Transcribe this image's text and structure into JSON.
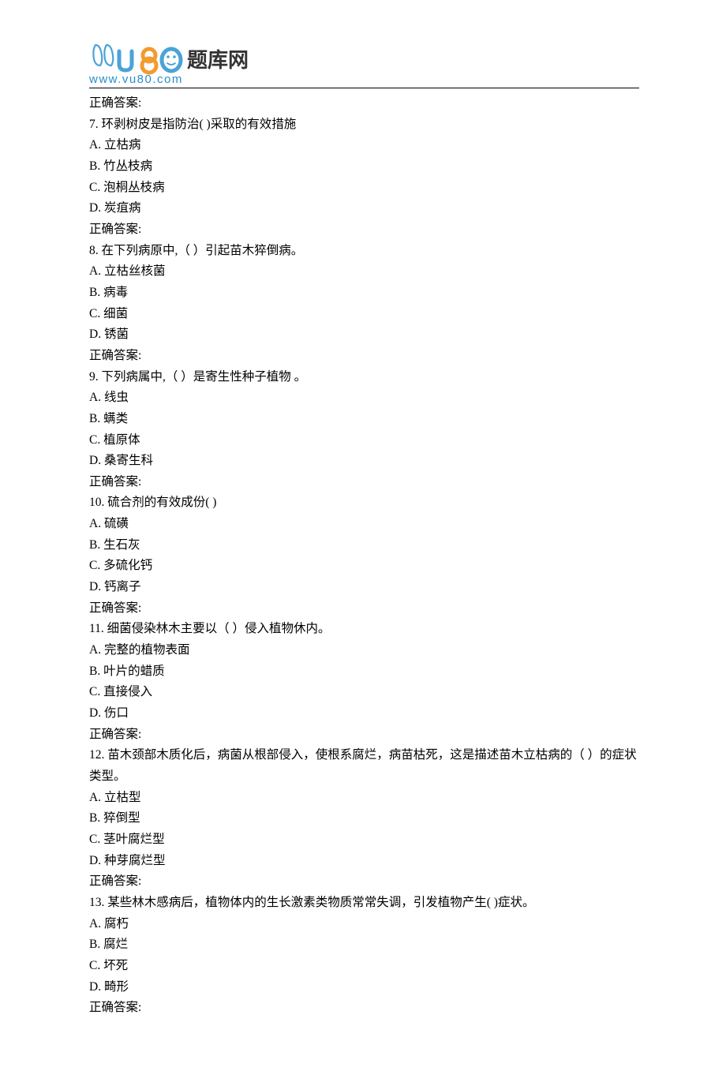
{
  "logo": {
    "url_text": "www.vu80.com",
    "title_text": "题库网"
  },
  "items": [
    {
      "text": "正确答案:"
    },
    {
      "text": "7.   环剥树皮是指防治( )采取的有效措施"
    },
    {
      "text": "A. 立枯病"
    },
    {
      "text": "B. 竹丛枝病"
    },
    {
      "text": "C. 泡桐丛枝病"
    },
    {
      "text": "D. 炭疽病"
    },
    {
      "text": "正确答案:"
    },
    {
      "text": "8.   在下列病原中,（  ）引起苗木猝倒病。"
    },
    {
      "text": "A. 立枯丝核菌"
    },
    {
      "text": "B. 病毒"
    },
    {
      "text": "C. 细菌"
    },
    {
      "text": "D. 锈菌"
    },
    {
      "text": "正确答案:"
    },
    {
      "text": "9.   下列病属中,（  ）是寄生性种子植物 。"
    },
    {
      "text": "A. 线虫"
    },
    {
      "text": "B. 螨类"
    },
    {
      "text": "C. 植原体"
    },
    {
      "text": "D. 桑寄生科"
    },
    {
      "text": "正确答案:"
    },
    {
      "text": "10.   硫合剂的有效成份( )"
    },
    {
      "text": "A. 硫磺"
    },
    {
      "text": "B. 生石灰"
    },
    {
      "text": "C. 多硫化钙"
    },
    {
      "text": "D. 钙离子"
    },
    {
      "text": "正确答案:"
    },
    {
      "text": "11.   细菌侵染林木主要以（  ）侵入植物休内。"
    },
    {
      "text": "A. 完整的植物表面"
    },
    {
      "text": "B. 叶片的蜡质"
    },
    {
      "text": "C. 直接侵入"
    },
    {
      "text": "D. 伤口"
    },
    {
      "text": "正确答案:"
    },
    {
      "text": "12.   苗木颈部木质化后，病菌从根部侵入，使根系腐烂，病苗枯死，这是描述苗木立枯病的（  ）的症状类型。"
    },
    {
      "text": "A. 立枯型"
    },
    {
      "text": "B. 猝倒型"
    },
    {
      "text": "C. 茎叶腐烂型"
    },
    {
      "text": "D. 种芽腐烂型"
    },
    {
      "text": "正确答案:"
    },
    {
      "text": "13.   某些林木感病后，植物体内的生长激素类物质常常失调，引发植物产生( )症状。"
    },
    {
      "text": "A. 腐朽"
    },
    {
      "text": "B. 腐烂"
    },
    {
      "text": "C. 坏死"
    },
    {
      "text": "D. 畸形"
    },
    {
      "text": "正确答案:"
    }
  ]
}
